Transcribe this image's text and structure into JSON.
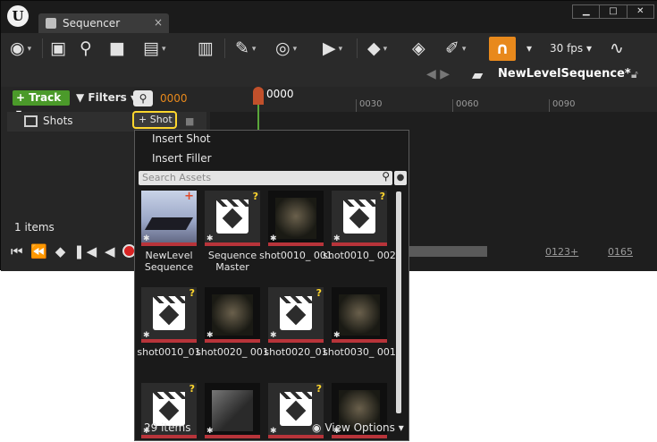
{
  "window": {
    "tab_title": "Sequencer",
    "tab_close": "×",
    "controls": [
      "▁",
      "□",
      "✕"
    ],
    "logo_text": "U"
  },
  "toolbar": {
    "fps_label": "30 fps",
    "dropdown_glyph": "▾"
  },
  "breadcrumb": {
    "back": "◀ ▶",
    "sequence_name": "NewLevelSequence*"
  },
  "left_panel": {
    "track_button": "+ Track ▾",
    "filters_button": "▼ Filters ▾",
    "timecode": "0000",
    "shots_track_label": "Shots",
    "shot_button": "+ Shot",
    "items_count": "1 items"
  },
  "timeline": {
    "playhead_time": "0000",
    "ruler_labels": [
      "0030",
      "0060",
      "0090"
    ],
    "start_time": "0123+",
    "end_time": "0165"
  },
  "shot_menu": {
    "insert_shot": "Insert Shot",
    "insert_filler": "Insert Filler",
    "search_placeholder": "Search Assets",
    "items_count": "29 items",
    "view_options": "View Options ▾",
    "assets": [
      {
        "label": "NewLevel Sequence",
        "kind": "level"
      },
      {
        "label": "Sequence Master",
        "kind": "seq"
      },
      {
        "label": "shot0010_ 001",
        "kind": "shot"
      },
      {
        "label": "shot0010_ 002",
        "kind": "seq"
      },
      {
        "label": "shot0010_01",
        "kind": "seq"
      },
      {
        "label": "shot0020_ 001",
        "kind": "shot"
      },
      {
        "label": "shot0020_01",
        "kind": "seq"
      },
      {
        "label": "shot0030_ 001",
        "kind": "shot"
      },
      {
        "label": "",
        "kind": "seq"
      },
      {
        "label": "",
        "kind": "shot"
      },
      {
        "label": "",
        "kind": "seq"
      },
      {
        "label": "",
        "kind": "shot"
      }
    ]
  },
  "colors": {
    "accent_orange": "#e8891c",
    "track_green": "#4b9a2a",
    "highlight_yellow": "#ffd72e",
    "asset_bar_red": "#b8343a"
  }
}
